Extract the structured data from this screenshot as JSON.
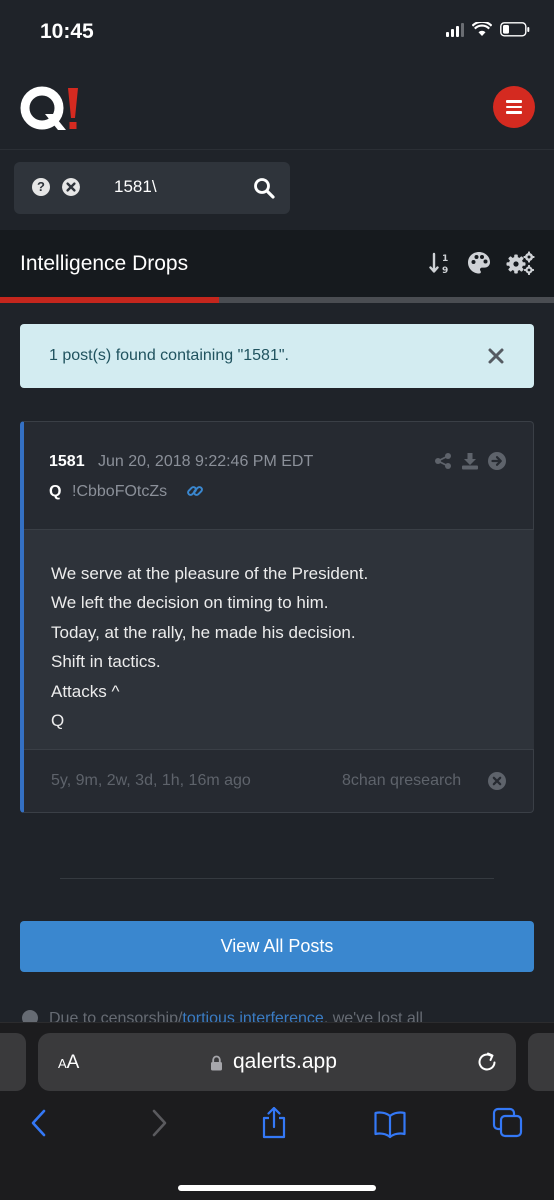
{
  "status_bar": {
    "time": "10:45"
  },
  "header": {
    "logo_text": "Q!",
    "accent_color": "#d42a20"
  },
  "search": {
    "value": "1581\\",
    "help_icon": "question-circle-icon",
    "clear_icon": "times-circle-icon",
    "submit_icon": "search-icon"
  },
  "section": {
    "title": "Intelligence Drops",
    "progress_fraction": 0.395
  },
  "alert": {
    "text": "1 post(s) found containing \"1581\"."
  },
  "post": {
    "number": "1581",
    "date": "Jun 20, 2018 9:22:46 PM EDT",
    "author": "Q",
    "tripcode": "!CbboFOtcZs",
    "lines": [
      "We serve at the pleasure of the President.",
      "We left the decision on timing to him.",
      "Today, at the rally, he made his decision.",
      "Shift in tactics.",
      "Attacks ^",
      "Q"
    ],
    "ago": "5y, 9m, 2w, 3d, 1h, 16m ago",
    "source": "8chan qresearch",
    "border_color": "#3470c3"
  },
  "view_all": {
    "label": "View All Posts"
  },
  "notice": {
    "before": "Due to censorship/",
    "link": "tortious interference",
    "after": ", we've lost all"
  },
  "browser": {
    "aa_small": "A",
    "aa_big": "A",
    "url": "qalerts.app"
  }
}
